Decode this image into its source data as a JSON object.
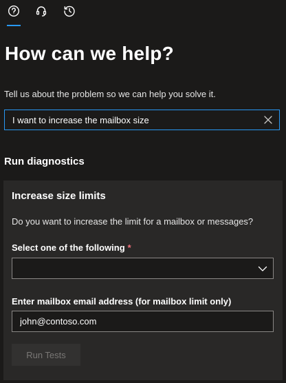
{
  "tabs": [
    {
      "icon": "help-icon",
      "active": true
    },
    {
      "icon": "headset-icon",
      "active": false
    },
    {
      "icon": "history-icon",
      "active": false
    }
  ],
  "heading": "How can we help?",
  "subtitle": "Tell us about the problem so we can help you solve it.",
  "search": {
    "value": "I want to increase the mailbox size"
  },
  "diagnostics": {
    "title": "Run diagnostics",
    "panel_title": "Increase size limits",
    "question": "Do you want to increase the limit for a mailbox or messages?",
    "select_label": "Select one of the following",
    "required_mark": "*",
    "select_value": "",
    "email_label": "Enter mailbox email address (for mailbox limit only)",
    "email_value": "john@contoso.com",
    "run_label": "Run Tests"
  },
  "colors": {
    "background": "#1b1a19",
    "panel": "#292827",
    "accent": "#2899f5",
    "required": "#f1707b"
  }
}
